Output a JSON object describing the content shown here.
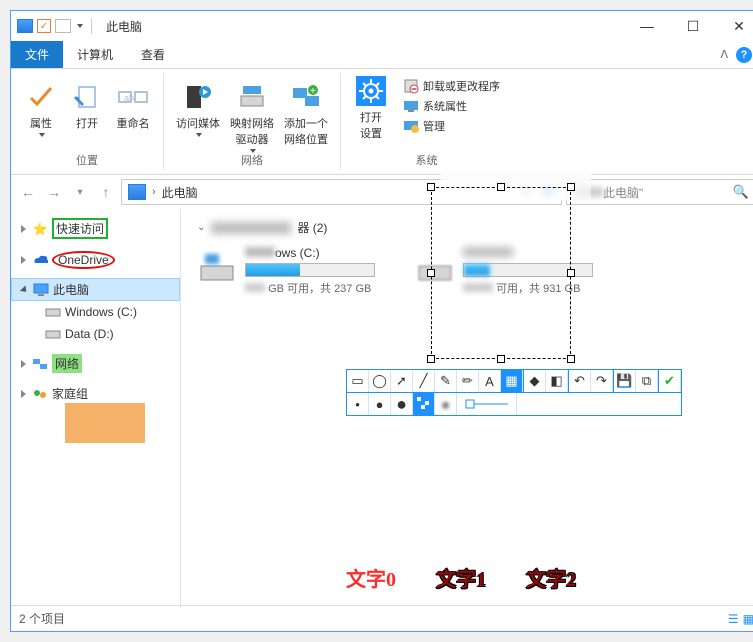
{
  "title": "此电脑",
  "tabs": {
    "file": "文件",
    "computer": "计算机",
    "view": "查看"
  },
  "ribbon": {
    "groups": {
      "location": {
        "label": "位置",
        "properties": "属性",
        "open": "打开",
        "rename": "重命名"
      },
      "network": {
        "label": "网络",
        "media": "访问媒体",
        "map_drive": "映射网络\n驱动器",
        "add_loc": "添加一个\n网络位置"
      },
      "system": {
        "label": "系统",
        "settings": "打开\n设置",
        "uninstall": "卸载或更改程序",
        "sys_prop": "系统属性",
        "manage": "管理"
      }
    }
  },
  "addr": {
    "path": "此电脑",
    "refresh": "⟳"
  },
  "search": {
    "placeholder_prefix": "\"",
    "placeholder_suffix": "此电脑\""
  },
  "sidebar": {
    "quick": "快速访问",
    "onedrive": "OneDrive",
    "this_pc": "此电脑",
    "windows_c": "Windows (C:)",
    "data_d": "Data (D:)",
    "network": "网络",
    "homegroup": "家庭组"
  },
  "content": {
    "cat_suffix": "器 (2)",
    "drive_c": {
      "name_suffix": "ows (C:)",
      "fill_pct": 42,
      "stat_mid": "GB 可用，共 237 GB"
    },
    "drive_d": {
      "name_blur": true,
      "fill_pct": 20,
      "stat": "可用，共 931 GB"
    }
  },
  "footer": {
    "items": "2 个项目"
  },
  "overlay_texts": [
    "文字0",
    "文字1",
    "文字2"
  ]
}
